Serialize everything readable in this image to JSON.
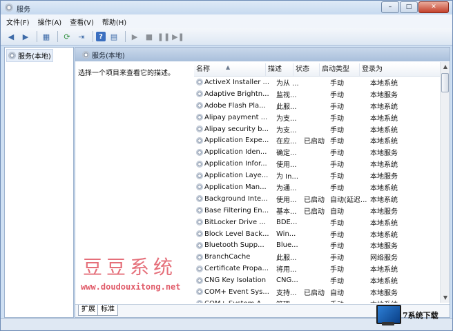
{
  "window": {
    "title": "服务",
    "min": "–",
    "max": "□",
    "close": "✕"
  },
  "menu": [
    "文件(F)",
    "操作(A)",
    "查看(V)",
    "帮助(H)"
  ],
  "toolbar": {
    "icons": [
      "back-icon",
      "forward-icon",
      "console-tree-icon",
      "refresh-icon",
      "export-icon",
      "help-icon",
      "properties-icon",
      "start-icon",
      "stop-icon",
      "pause-icon",
      "restart-icon"
    ]
  },
  "tree": {
    "root": "服务(本地)"
  },
  "content": {
    "header": "服务(本地)",
    "description_hint": "选择一个项目来查看它的描述。",
    "columns": [
      "名称",
      "描述",
      "状态",
      "启动类型",
      "登录为"
    ],
    "rows": [
      [
        "ActiveX Installer ...",
        "为从 ...",
        "",
        "手动",
        "本地系统"
      ],
      [
        "Adaptive Brightn...",
        "监视...",
        "",
        "手动",
        "本地服务"
      ],
      [
        "Adobe Flash Pla...",
        "此服...",
        "",
        "手动",
        "本地系统"
      ],
      [
        "Alipay payment ...",
        "为支...",
        "",
        "手动",
        "本地系统"
      ],
      [
        "Alipay security b...",
        "为支...",
        "",
        "手动",
        "本地系统"
      ],
      [
        "Application Expe...",
        "在应...",
        "已启动",
        "手动",
        "本地系统"
      ],
      [
        "Application Iden...",
        "确定...",
        "",
        "手动",
        "本地服务"
      ],
      [
        "Application Infor...",
        "使用...",
        "",
        "手动",
        "本地系统"
      ],
      [
        "Application Laye...",
        "为 In...",
        "",
        "手动",
        "本地服务"
      ],
      [
        "Application Man...",
        "为通...",
        "",
        "手动",
        "本地系统"
      ],
      [
        "Background Inte...",
        "使用...",
        "已启动",
        "自动(延迟...",
        "本地系统"
      ],
      [
        "Base Filtering En...",
        "基本...",
        "已启动",
        "自动",
        "本地服务"
      ],
      [
        "BitLocker Drive ...",
        "BDE...",
        "",
        "手动",
        "本地系统"
      ],
      [
        "Block Level Back...",
        "Win...",
        "",
        "手动",
        "本地系统"
      ],
      [
        "Bluetooth Supp...",
        "Blue...",
        "",
        "手动",
        "本地服务"
      ],
      [
        "BranchCache",
        "此服...",
        "",
        "手动",
        "网络服务"
      ],
      [
        "Certificate Propa...",
        "将用...",
        "",
        "手动",
        "本地系统"
      ],
      [
        "CNG Key Isolation",
        "CNG...",
        "",
        "手动",
        "本地系统"
      ],
      [
        "COM+ Event Sys...",
        "支持...",
        "已启动",
        "自动",
        "本地服务"
      ],
      [
        "COM+ System A...",
        "管理...",
        "",
        "手动",
        "本地系统"
      ]
    ]
  },
  "tabs": [
    "扩展",
    "标准"
  ],
  "watermark": {
    "title": "豆豆系统",
    "url": "www.doudouxitong.net"
  },
  "corner_logo": {
    "text": "7系统下载"
  }
}
